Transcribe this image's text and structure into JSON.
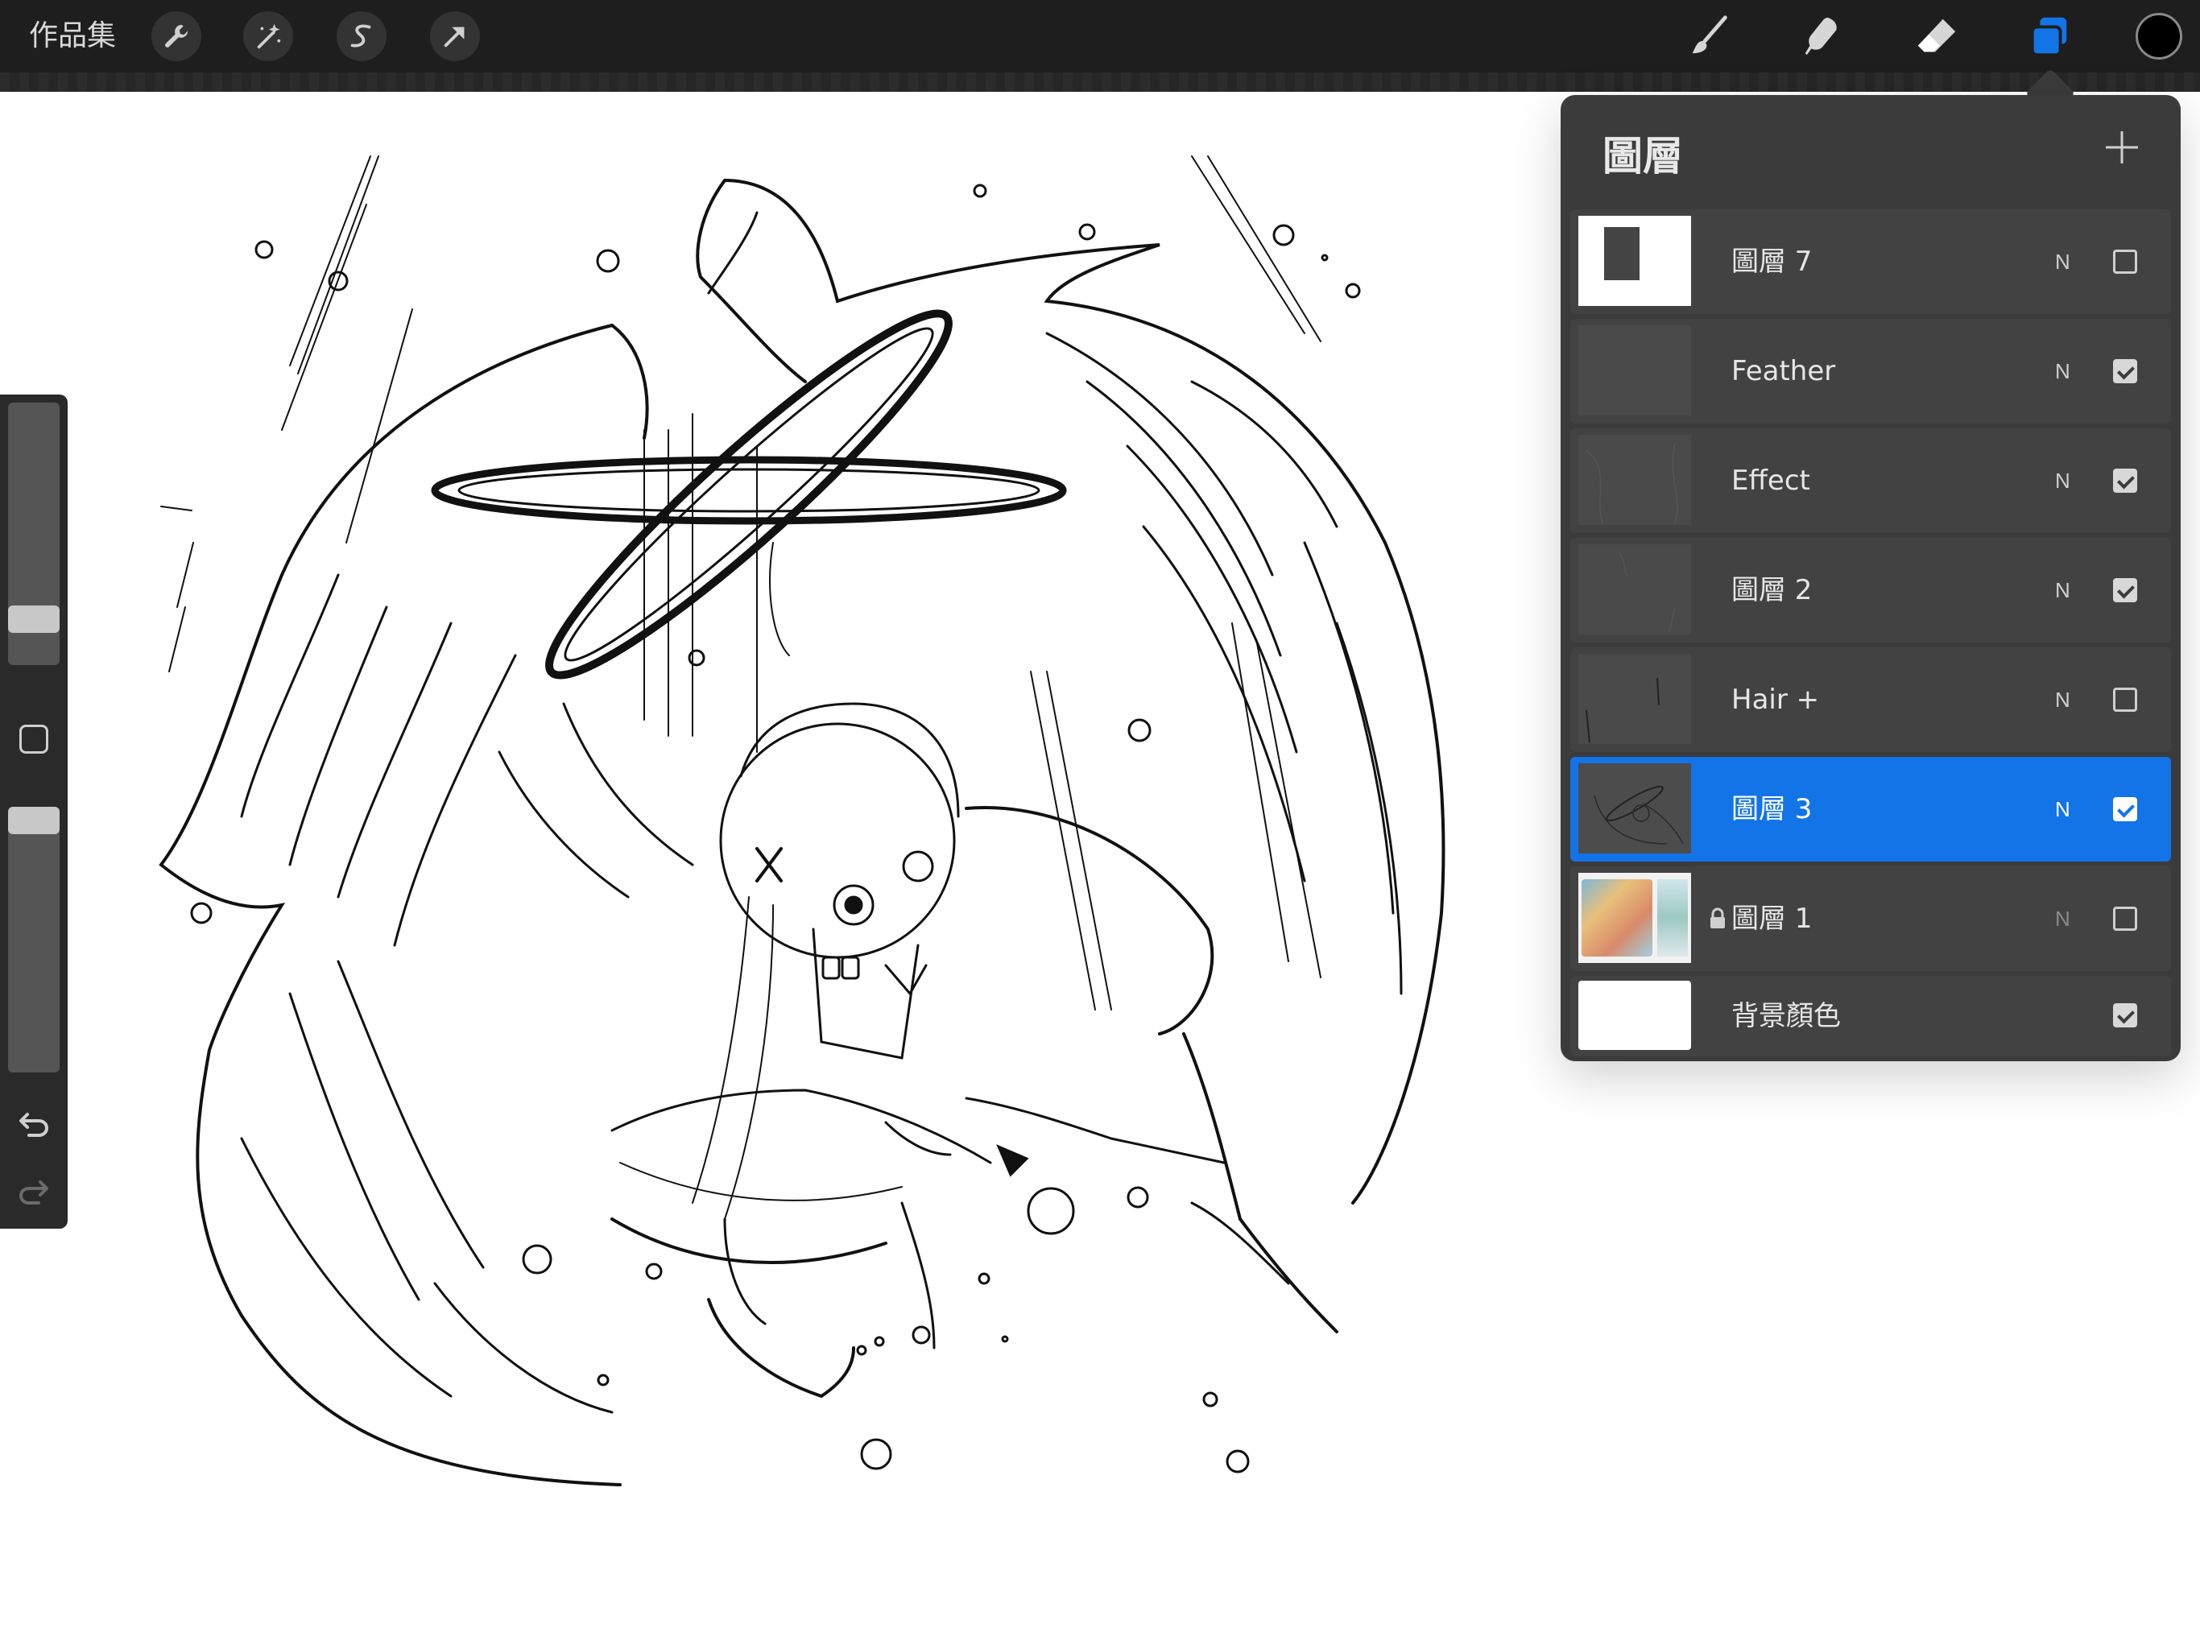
{
  "toolbar": {
    "gallery_label": "作品集",
    "left_tools": [
      "wrench-icon",
      "magic-wand-icon",
      "selection-s-icon",
      "transform-arrow-icon"
    ],
    "right_tools": [
      "brush-icon",
      "smudge-icon",
      "eraser-icon",
      "layers-icon"
    ],
    "active_tool": "layers-icon",
    "active_color": "#1374e8",
    "current_color": "#000000"
  },
  "sidebar": {
    "brush_size_level": 0.78,
    "opacity_level": 0.95,
    "icons": [
      "modify-square-icon",
      "undo-icon",
      "redo-icon"
    ]
  },
  "layers_panel": {
    "title": "圖層",
    "add_icon": "plus-icon",
    "layers": [
      {
        "name": "圖層 7",
        "blend": "N",
        "visible": false,
        "active": false,
        "locked": false
      },
      {
        "name": "Feather",
        "blend": "N",
        "visible": true,
        "active": false,
        "locked": false
      },
      {
        "name": "Effect",
        "blend": "N",
        "visible": true,
        "active": false,
        "locked": false
      },
      {
        "name": "圖層 2",
        "blend": "N",
        "visible": true,
        "active": false,
        "locked": false
      },
      {
        "name": "Hair +",
        "blend": "N",
        "visible": false,
        "active": false,
        "locked": false
      },
      {
        "name": "圖層 3",
        "blend": "N",
        "visible": true,
        "active": true,
        "locked": false
      },
      {
        "name": "圖層 1",
        "blend": "N",
        "visible": false,
        "active": false,
        "locked": true
      },
      {
        "name": "背景顏色",
        "blend": "",
        "visible": true,
        "active": false,
        "locked": false
      }
    ]
  }
}
